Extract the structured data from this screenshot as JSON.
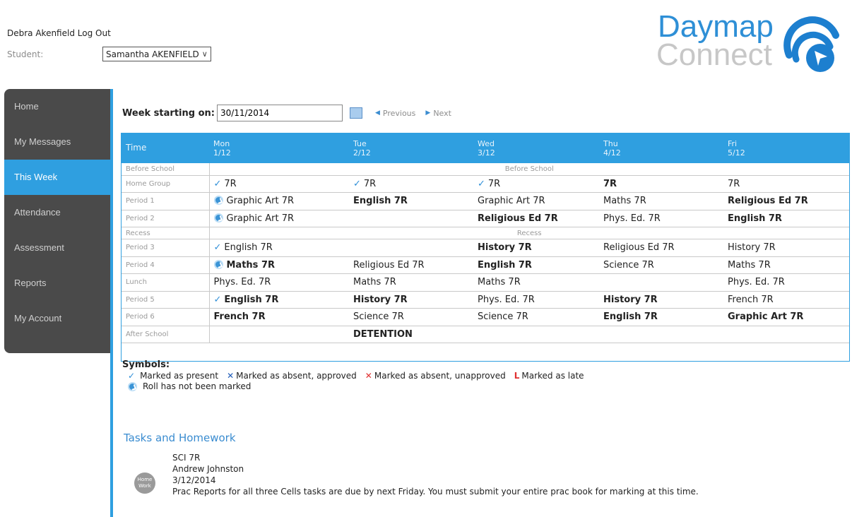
{
  "header": {
    "user_name": "Debra Akenfield",
    "logout": "Log Out",
    "student_label": "Student:",
    "student_value": "Samantha AKENFIELD"
  },
  "logo": {
    "line1": "Daymap",
    "line2": "Connect",
    "icon": "daymap-logo-icon"
  },
  "sidebar": {
    "items": [
      {
        "label": "Home",
        "active": false
      },
      {
        "label": "My Messages",
        "active": false
      },
      {
        "label": "This Week",
        "active": true
      },
      {
        "label": "Attendance",
        "active": false
      },
      {
        "label": "Assessment",
        "active": false
      },
      {
        "label": "Reports",
        "active": false
      },
      {
        "label": "My Account",
        "active": false
      }
    ]
  },
  "week": {
    "label": "Week starting on:",
    "value": "30/11/2014",
    "previous": "Previous",
    "next": "Next"
  },
  "timetable": {
    "headers": {
      "time": "Time",
      "days": [
        {
          "day": "Mon",
          "date": "1/12"
        },
        {
          "day": "Tue",
          "date": "2/12"
        },
        {
          "day": "Wed",
          "date": "3/12"
        },
        {
          "day": "Thu",
          "date": "4/12"
        },
        {
          "day": "Fri",
          "date": "5/12"
        }
      ]
    },
    "before_school": {
      "label": "Before School",
      "text": "Before School"
    },
    "home_group": {
      "label": "Home Group",
      "cells": [
        "7R",
        "7R",
        "7R",
        "7R",
        "7R"
      ]
    },
    "period1": {
      "label": "Period 1",
      "cells": [
        "Graphic Art 7R",
        "English 7R",
        "Graphic Art 7R",
        "Maths 7R",
        "Religious Ed 7R"
      ]
    },
    "period2": {
      "label": "Period 2",
      "cells": [
        "Graphic Art 7R",
        "",
        "Religious Ed 7R",
        "Phys. Ed. 7R",
        "English 7R"
      ]
    },
    "recess": {
      "label": "Recess",
      "text": "Recess"
    },
    "period3": {
      "label": "Period 3",
      "cells": [
        "English 7R",
        "",
        "History 7R",
        "Religious Ed 7R",
        "History 7R"
      ]
    },
    "period4": {
      "label": "Period 4",
      "cells": [
        "Maths 7R",
        "Religious Ed 7R",
        "English 7R",
        "Science 7R",
        "Maths 7R"
      ]
    },
    "lunch": {
      "label": "Lunch",
      "cells": [
        "Phys. Ed. 7R",
        "Maths 7R",
        "Maths 7R",
        "",
        "Phys. Ed. 7R"
      ]
    },
    "period5": {
      "label": "Period 5",
      "cells": [
        "English 7R",
        "History 7R",
        "Phys. Ed. 7R",
        "History 7R",
        "French 7R"
      ]
    },
    "period6": {
      "label": "Period 6",
      "cells": [
        "French 7R",
        "Science 7R",
        "Science 7R",
        "English 7R",
        "Graphic Art 7R"
      ]
    },
    "after_school": {
      "label": "After School",
      "cells": [
        "",
        "DETENTION",
        "",
        "",
        ""
      ]
    }
  },
  "symbols": {
    "title": "Symbols:",
    "present": "Marked as present",
    "absent_approved": "Marked as absent, approved",
    "absent_unapproved": "Marked as absent, unapproved",
    "late": "Marked as late",
    "not_marked": "Roll has not been marked"
  },
  "tasks": {
    "title": "Tasks and Homework",
    "icon_text": "Home Work",
    "subject": "SCI 7R",
    "teacher": "Andrew Johnston",
    "date": "3/12/2014",
    "description": "Prac Reports for all three Cells tasks are due by next Friday. You must submit your entire prac book for marking at this time."
  },
  "colors": {
    "accent": "#2f9fe0",
    "sidebar": "#4a4a4a",
    "tick": "#2f8fd8",
    "absent_unapproved": "#e03030",
    "absent_approved": "#1e5bb8"
  }
}
